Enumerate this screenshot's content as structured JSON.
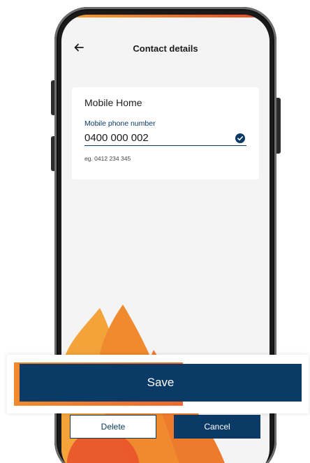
{
  "colors": {
    "primary_navy": "#0b3a66",
    "accent_orange": "#f08a2e",
    "accent_red": "#e8472b",
    "screen_background": "#f4f4f5"
  },
  "header": {
    "back_icon": "arrow-left-icon",
    "title": "Contact details"
  },
  "contact_card": {
    "title": "Mobile Home",
    "field_label": "Mobile phone number",
    "field_value": "0400 000 002",
    "valid_icon": "check-circle-icon",
    "helper_text": "eg. 0412 234 345"
  },
  "actions": {
    "save_label": "Save",
    "delete_label": "Delete",
    "cancel_label": "Cancel"
  }
}
